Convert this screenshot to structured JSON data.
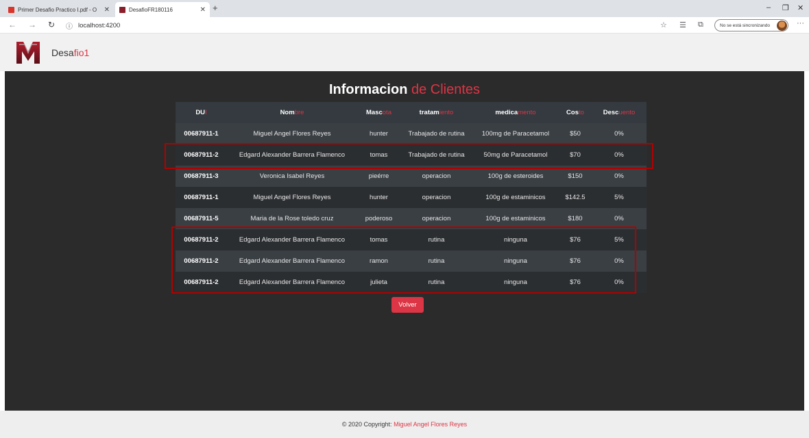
{
  "browser": {
    "tabs": [
      {
        "label": "Primer Desafio Practico I.pdf - O"
      },
      {
        "label": "DesafioFR180116"
      }
    ],
    "new_tab_symbol": "+",
    "address": "localhost:4200",
    "sync_label": "No se está sincronizando",
    "controls": {
      "minimize": "–",
      "restore": "❐",
      "close": "✕",
      "more": "···"
    }
  },
  "app": {
    "brand_prefix": "Desa",
    "brand_accent": "fio1"
  },
  "page": {
    "title_main": "Informacion",
    "title_accent": "de Clientes",
    "volver_label": "Volver"
  },
  "table": {
    "headers": [
      {
        "main": "DU",
        "accent": "I"
      },
      {
        "main": "Nom",
        "accent": "bre"
      },
      {
        "main": "Masc",
        "accent": "ota"
      },
      {
        "main": "tratam",
        "accent": "iento"
      },
      {
        "main": "medica",
        "accent": "mento"
      },
      {
        "main": "Cos",
        "accent": "to"
      },
      {
        "main": "Desc",
        "accent": "uento"
      }
    ],
    "rows": [
      [
        "00687911-1",
        "Miguel Angel Flores Reyes",
        "hunter",
        "Trabajado de rutina",
        "100mg de Paracetamol",
        "$50",
        "0%"
      ],
      [
        "00687911-2",
        "Edgard Alexander Barrera Flamenco",
        "tomas",
        "Trabajado de rutina",
        "50mg de Paracetamol",
        "$70",
        "0%"
      ],
      [
        "00687911-3",
        "Veronica Isabel Reyes",
        "pieérre",
        "operacion",
        "100g de esteroides",
        "$150",
        "0%"
      ],
      [
        "00687911-1",
        "Miguel Angel Flores Reyes",
        "hunter",
        "operacion",
        "100g de estaminicos",
        "$142.5",
        "5%"
      ],
      [
        "00687911-5",
        "Maria de la Rose toledo cruz",
        "poderoso",
        "operacion",
        "100g de estaminicos",
        "$180",
        "0%"
      ],
      [
        "00687911-2",
        "Edgard Alexander Barrera Flamenco",
        "tomas",
        "rutina",
        "ninguna",
        "$76",
        "5%"
      ],
      [
        "00687911-2",
        "Edgard Alexander Barrera Flamenco",
        "ramon",
        "rutina",
        "ninguna",
        "$76",
        "0%"
      ],
      [
        "00687911-2",
        "Edgard Alexander Barrera Flamenco",
        "julieta",
        "rutina",
        "ninguna",
        "$76",
        "0%"
      ]
    ]
  },
  "footer": {
    "prefix": "© 2020 Copyright:",
    "author": "Miguel Angel Flores Reyes"
  },
  "colors": {
    "accent": "#dc3545",
    "dark_bg": "#2b2b2b",
    "highlight": "#b30000"
  },
  "icons": [
    "pdf-icon",
    "app-favicon-icon",
    "back-icon",
    "forward-icon",
    "refresh-icon",
    "info-icon",
    "star-icon",
    "favorites-icon",
    "collections-icon",
    "profile-avatar-icon",
    "app-logo-icon"
  ]
}
